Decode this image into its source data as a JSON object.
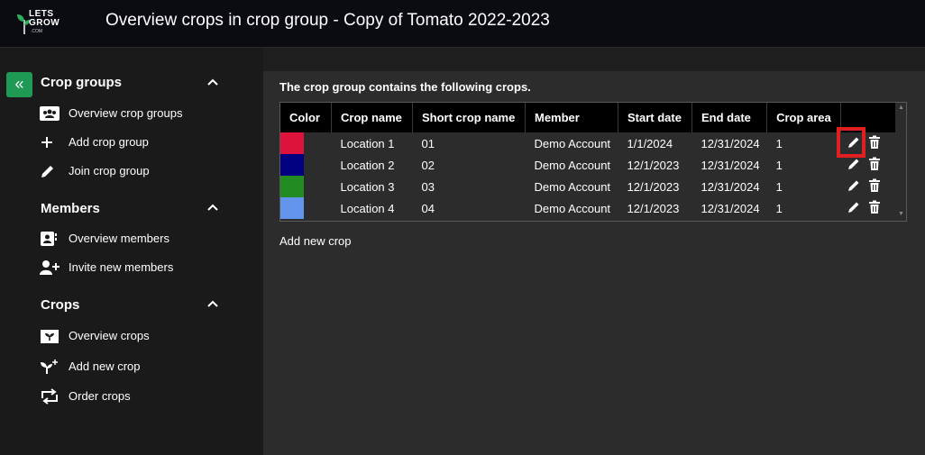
{
  "header": {
    "logo": {
      "line1": "LETS",
      "line2": "GROW",
      "line3": ".COM"
    },
    "title": "Overview crops in crop group - Copy of Tomato 2022-2023"
  },
  "sidebar": {
    "collapse_label": "«",
    "sections": [
      {
        "title": "Crop groups",
        "items": [
          {
            "label": "Overview crop groups",
            "icon": "group-icon"
          },
          {
            "label": "Add crop group",
            "icon": "plus-icon"
          },
          {
            "label": "Join crop group",
            "icon": "pencil-icon"
          }
        ]
      },
      {
        "title": "Members",
        "items": [
          {
            "label": "Overview members",
            "icon": "contact-book-icon"
          },
          {
            "label": "Invite new members",
            "icon": "add-person-icon"
          }
        ]
      },
      {
        "title": "Crops",
        "items": [
          {
            "label": "Overview crops",
            "icon": "crop-folder-icon"
          },
          {
            "label": "Add new crop",
            "icon": "add-plant-icon"
          },
          {
            "label": "Order crops",
            "icon": "reorder-icon"
          }
        ]
      }
    ]
  },
  "main": {
    "intro": "The crop group contains the following crops.",
    "table": {
      "columns": [
        "Color",
        "Crop name",
        "Short crop name",
        "Member",
        "Start date",
        "End date",
        "Crop area",
        ""
      ],
      "rows": [
        {
          "color": "#dc143c",
          "name": "Location 1",
          "short": "01",
          "member": "Demo Account",
          "start": "1/1/2024",
          "end": "12/31/2024",
          "area": "1"
        },
        {
          "color": "#000080",
          "name": "Location 2",
          "short": "02",
          "member": "Demo Account",
          "start": "12/1/2023",
          "end": "12/31/2024",
          "area": "1"
        },
        {
          "color": "#228b22",
          "name": "Location 3",
          "short": "03",
          "member": "Demo Account",
          "start": "12/1/2023",
          "end": "12/31/2024",
          "area": "1"
        },
        {
          "color": "#6495ed",
          "name": "Location 4",
          "short": "04",
          "member": "Demo Account",
          "start": "12/1/2023",
          "end": "12/31/2024",
          "area": "1"
        }
      ]
    },
    "add_link": "Add new crop"
  },
  "colors": {
    "accent": "#1f9a55",
    "highlight": "#e02020"
  }
}
